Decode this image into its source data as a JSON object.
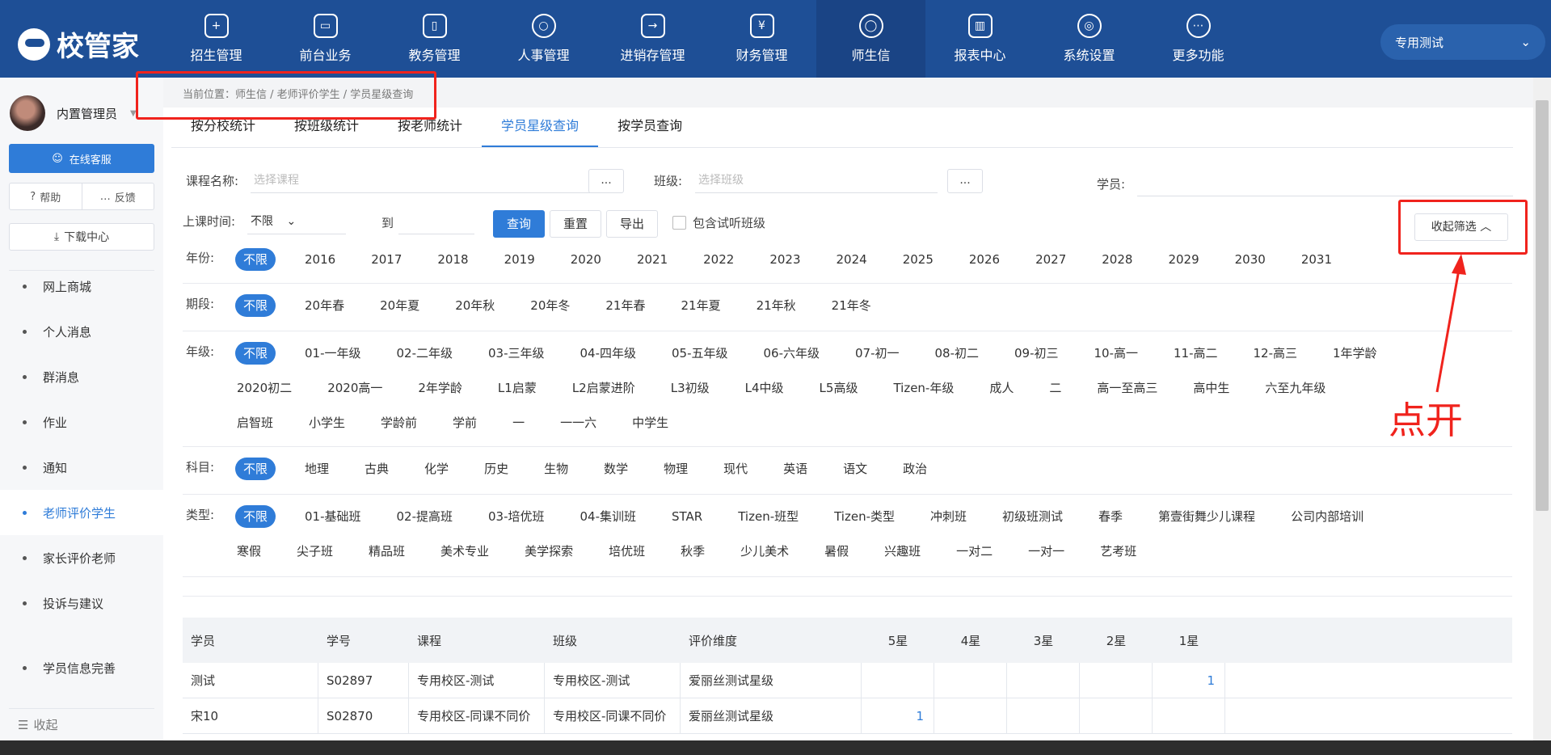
{
  "brand": {
    "name": "校管家"
  },
  "nav": [
    {
      "label": "招生管理",
      "icon": "user-add-icon"
    },
    {
      "label": "前台业务",
      "icon": "desk-icon"
    },
    {
      "label": "教务管理",
      "icon": "book-icon"
    },
    {
      "label": "人事管理",
      "icon": "person-icon"
    },
    {
      "label": "进销存管理",
      "icon": "inventory-icon"
    },
    {
      "label": "财务管理",
      "icon": "yuan-icon"
    },
    {
      "label": "师生信",
      "icon": "chat-icon"
    },
    {
      "label": "报表中心",
      "icon": "chart-icon"
    },
    {
      "label": "系统设置",
      "icon": "gear-icon"
    },
    {
      "label": "更多功能",
      "icon": "more-icon"
    }
  ],
  "campus_select": {
    "value": "专用测试"
  },
  "sidebar": {
    "user_name": "内置管理员",
    "online_service": "在线客服",
    "help": "帮助",
    "feedback": "反馈",
    "download_center": "下载中心",
    "menu": [
      "网上商城",
      "个人消息",
      "群消息",
      "作业",
      "通知",
      "老师评价学生",
      "家长评价老师",
      "投诉与建议",
      "学员信息完善"
    ],
    "collapse": "收起"
  },
  "breadcrumb": "当前位置：师生信 / 老师评价学生 / 学员星级查询",
  "tabs": [
    "按分校统计",
    "按班级统计",
    "按老师统计",
    "学员星级查询",
    "按学员查询"
  ],
  "form": {
    "course_label": "课程名称:",
    "course_placeholder": "选择课程",
    "class_label": "班级:",
    "class_placeholder": "选择班级",
    "student_label": "学员:",
    "dots": "...",
    "time_label": "上课时间:",
    "time_value": "不限",
    "to_label": "到",
    "query": "查询",
    "reset": "重置",
    "export": "导出",
    "include_trial": "包含试听班级",
    "collapse_filter": "收起筛选"
  },
  "filters": {
    "year": {
      "label": "年份:",
      "options": [
        "不限",
        "2016",
        "2017",
        "2018",
        "2019",
        "2020",
        "2021",
        "2022",
        "2023",
        "2024",
        "2025",
        "2026",
        "2027",
        "2028",
        "2029",
        "2030",
        "2031"
      ]
    },
    "term": {
      "label": "期段:",
      "options": [
        "不限",
        "20年春",
        "20年夏",
        "20年秋",
        "20年冬",
        "21年春",
        "21年夏",
        "21年秋",
        "21年冬"
      ]
    },
    "grade": {
      "label": "年级:",
      "options": [
        "不限",
        "01-一年级",
        "02-二年级",
        "03-三年级",
        "04-四年级",
        "05-五年级",
        "06-六年级",
        "07-初一",
        "08-初二",
        "09-初三",
        "10-高一",
        "11-高二",
        "12-高三",
        "1年学龄",
        "2020初二",
        "2020高一",
        "2年学龄",
        "L1启蒙",
        "L2启蒙进阶",
        "L3初级",
        "L4中级",
        "L5高级",
        "Tizen-年级",
        "成人",
        "二",
        "高一至高三",
        "高中生",
        "六至九年级",
        "启智班",
        "小学生",
        "学龄前",
        "学前",
        "一",
        "一一六",
        "中学生"
      ]
    },
    "subject": {
      "label": "科目:",
      "options": [
        "不限",
        "地理",
        "古典",
        "化学",
        "历史",
        "生物",
        "数学",
        "物理",
        "现代",
        "英语",
        "语文",
        "政治"
      ]
    },
    "type": {
      "label": "类型:",
      "options": [
        "不限",
        "01-基础班",
        "02-提高班",
        "03-培优班",
        "04-集训班",
        "STAR",
        "Tizen-班型",
        "Tizen-类型",
        "冲刺班",
        "初级班测试",
        "春季",
        "第壹街舞少儿课程",
        "公司内部培训",
        "寒假",
        "尖子班",
        "精品班",
        "美术专业",
        "美学探索",
        "培优班",
        "秋季",
        "少儿美术",
        "暑假",
        "兴趣班",
        "一对二",
        "一对一",
        "艺考班"
      ]
    }
  },
  "table": {
    "headers": [
      "学员",
      "学号",
      "课程",
      "班级",
      "评价维度",
      "5星",
      "4星",
      "3星",
      "2星",
      "1星"
    ],
    "rows": [
      [
        "测试",
        "S02897",
        "专用校区-测试",
        "专用校区-测试",
        "爱丽丝测试星级",
        "",
        "",
        "",
        "",
        "1"
      ],
      [
        "宋10",
        "S02870",
        "专用校区-同课不同价",
        "专用校区-同课不同价",
        "爱丽丝测试星级",
        "1",
        "",
        "",
        "",
        ""
      ]
    ]
  },
  "annotation": {
    "text": "点开",
    "color": "#f0231d"
  },
  "colors": {
    "header": "#1e4f96",
    "accent": "#2f7cd8",
    "highlight": "#f0231d"
  }
}
